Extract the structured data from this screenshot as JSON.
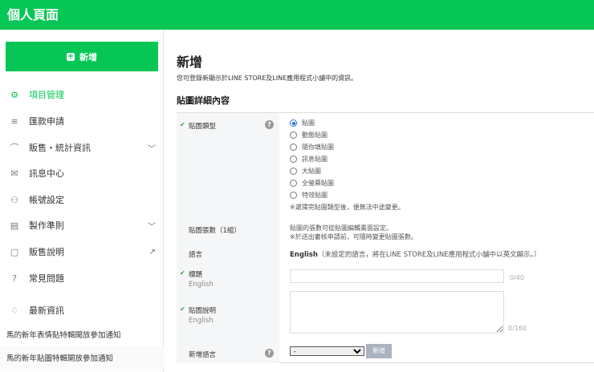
{
  "header": {
    "title": "個人頁面"
  },
  "sidebar": {
    "new_button": "新增",
    "items": [
      {
        "label": "項目管理",
        "icon": "gear-icon",
        "active": true
      },
      {
        "label": "匯款申請",
        "icon": "database-icon"
      },
      {
        "label": "販售・統計資訊",
        "icon": "chart-icon",
        "trail": "chevron-down-icon"
      },
      {
        "label": "訊息中心",
        "icon": "mail-icon"
      },
      {
        "label": "帳號設定",
        "icon": "user-icon"
      },
      {
        "label": "製作準則",
        "icon": "document-icon",
        "trail": "chevron-down-icon"
      },
      {
        "label": "販售說明",
        "icon": "note-icon",
        "trail": "external-link-icon"
      },
      {
        "label": "常見問題",
        "icon": "question-icon"
      },
      {
        "label": "最新資訊",
        "icon": "bell-icon"
      }
    ],
    "news": [
      "馬的新年表情貼特輯開放參加通知",
      "馬的新年貼圖特輯開放參加通知"
    ]
  },
  "main": {
    "title": "新增",
    "subtitle": "您可登錄新顯示於LINE STORE及LINE應用程式小舖中的資訊。",
    "section": "貼圖詳細內容",
    "type": {
      "label": "貼圖類型",
      "options": [
        "貼圖",
        "動態貼圖",
        "隨你填貼圖",
        "訊息貼圖",
        "大貼圖",
        "全螢幕貼圖",
        "特效貼圖"
      ],
      "selected": 0,
      "note": "※選擇完貼圖類型後，便無法中途變更。"
    },
    "count": {
      "label": "貼圖張數（1組）",
      "line1": "貼圖的張數可從貼圖編輯畫面設定。",
      "line2": "※於送出審核申請前，可隨時變更貼圖張數。"
    },
    "language": {
      "label": "語言",
      "value": "English",
      "note": "（未設定的語言，將在LINE STORE及LINE應用程式小舖中以英文顯示。）"
    },
    "title_field": {
      "label": "標題",
      "lang": "English",
      "value": "",
      "counter": "0/40"
    },
    "desc_field": {
      "label": "貼圖說明",
      "lang": "English",
      "value": "",
      "counter": "0/160"
    },
    "add_language": {
      "label": "新增語言",
      "selected": "-",
      "button": "新增"
    }
  }
}
